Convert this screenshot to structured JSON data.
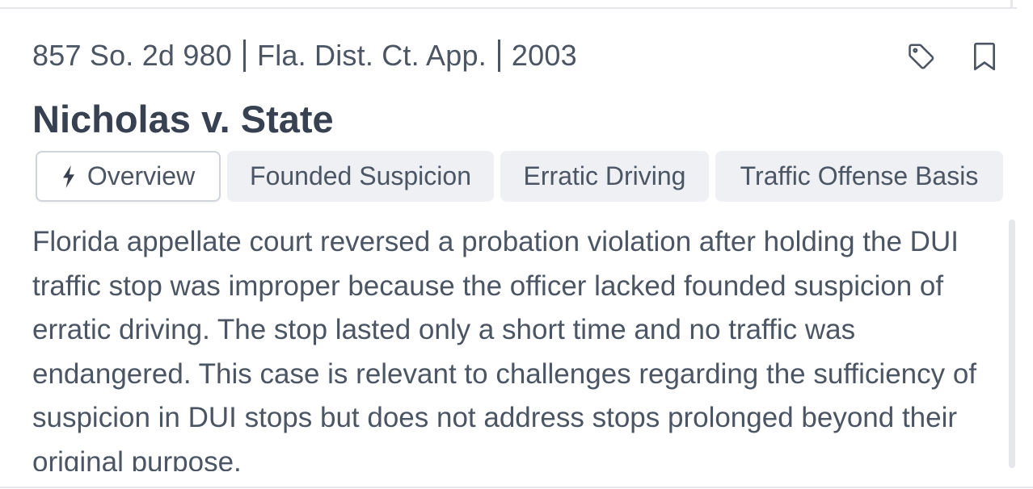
{
  "case": {
    "reporter": "857 So. 2d 980",
    "court": "Fla. Dist. Ct. App.",
    "year": "2003",
    "title": "Nicholas v. State"
  },
  "actions": {
    "tag_icon": "tag-icon",
    "bookmark_icon": "bookmark-icon"
  },
  "tabs": [
    {
      "label": "Overview",
      "icon": "lightning-bolt-icon",
      "active": true
    },
    {
      "label": "Founded Suspicion",
      "active": false
    },
    {
      "label": "Erratic Driving",
      "active": false
    },
    {
      "label": "Traffic Offense Basis",
      "active": false
    }
  ],
  "summary": "Florida appellate court reversed a probation violation after holding the DUI traffic stop was improper because the officer lacked founded suspicion of erratic driving. The stop lasted only a short time and no traffic was endangered. This case is relevant to challenges regarding the sufficiency of suspicion in DUI stops but does not address stops prolonged beyond their original purpose.",
  "colors": {
    "text": "#4b5563",
    "title": "#374151",
    "tab_bg": "#eef0f3",
    "border": "#e5e7eb"
  }
}
